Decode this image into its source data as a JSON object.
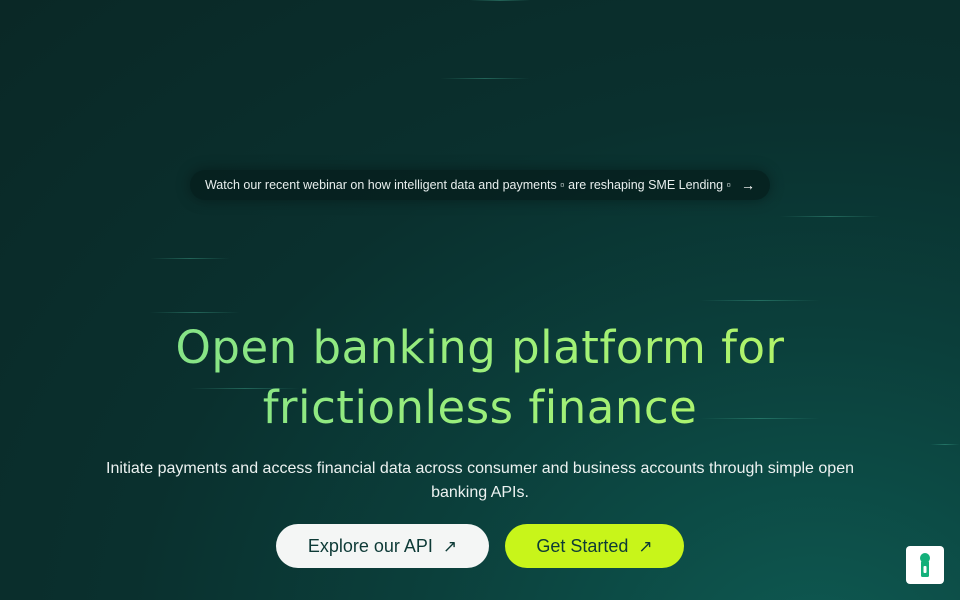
{
  "banner": {
    "text": "Watch our recent webinar on how intelligent data and payments ▫ are reshaping SME Lending ▫",
    "arrow_icon": "arrow-right-icon"
  },
  "hero": {
    "title_line1": "Open banking platform for",
    "title_line2": "frictionless finance",
    "subtitle": "Initiate payments and access financial data across consumer and business accounts through simple open banking APIs."
  },
  "buttons": {
    "explore_label": "Explore our API",
    "start_label": "Get Started",
    "icon": "arrow-up-right-icon"
  },
  "widget": {
    "icon": "keyhole-icon",
    "icon_color": "#13b07a"
  },
  "colors": {
    "accent": "#c8f51a",
    "background": "#0a302e",
    "title_gradient_start": "#7fe08a",
    "title_gradient_end": "#b7f563"
  }
}
